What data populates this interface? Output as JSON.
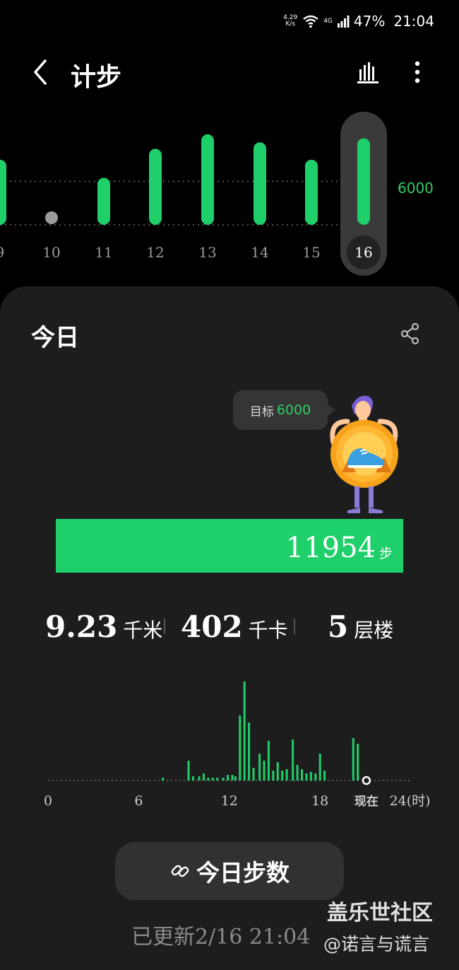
{
  "status_bar": {
    "speed_value": "4.29",
    "speed_unit": "K/s",
    "network": "4G",
    "battery": "47%",
    "time": "21:04"
  },
  "header": {
    "title": "计步",
    "back_icon": "back-icon",
    "chart_icon": "bar-chart-icon",
    "more_icon": "more-vert-icon"
  },
  "week_chart": {
    "goal": 6000,
    "goal_label": "6000",
    "days": [
      "9",
      "10",
      "11",
      "12",
      "13",
      "14",
      "15",
      "16"
    ],
    "steps": [
      9000,
      0,
      6500,
      10500,
      12500,
      11400,
      9000,
      11954
    ],
    "selected": "16",
    "colors": {
      "bar": "#1fcf6a",
      "empty_dot": "#9b9b9b",
      "selected_bg": "#3a3a3a"
    }
  },
  "card": {
    "title": "今日",
    "share_icon": "share-icon",
    "goal_bubble": {
      "label": "目标",
      "value": "6000"
    },
    "mascot_icon": "running-shoe-mascot",
    "steps": {
      "value": "11954",
      "unit": "步",
      "progress_fraction": 1.0
    },
    "stats": {
      "distance": {
        "value": "9.23",
        "unit": "千米"
      },
      "calories": {
        "value": "402",
        "unit": "千卡"
      },
      "floors": {
        "value": "5",
        "unit": "层楼"
      }
    },
    "hourly_chart": {
      "x_tick_labels": [
        "0",
        "6",
        "12",
        "18",
        "现在",
        "24(时)"
      ],
      "values": [
        [
          7.6,
          4
        ],
        [
          9.3,
          28
        ],
        [
          9.6,
          6
        ],
        [
          10.0,
          6
        ],
        [
          10.3,
          10
        ],
        [
          10.6,
          4
        ],
        [
          10.9,
          4
        ],
        [
          11.2,
          4
        ],
        [
          11.6,
          4
        ],
        [
          11.9,
          8
        ],
        [
          12.2,
          8
        ],
        [
          12.4,
          6
        ],
        [
          12.7,
          92
        ],
        [
          13.0,
          140
        ],
        [
          13.3,
          82
        ],
        [
          13.6,
          18
        ],
        [
          14.0,
          38
        ],
        [
          14.3,
          28
        ],
        [
          14.6,
          56
        ],
        [
          14.9,
          14
        ],
        [
          15.2,
          26
        ],
        [
          15.5,
          14
        ],
        [
          15.8,
          16
        ],
        [
          16.2,
          58
        ],
        [
          16.5,
          22
        ],
        [
          16.8,
          16
        ],
        [
          17.1,
          10
        ],
        [
          17.4,
          12
        ],
        [
          17.7,
          10
        ],
        [
          18.0,
          38
        ],
        [
          18.3,
          14
        ],
        [
          20.2,
          60
        ],
        [
          20.5,
          52
        ]
      ],
      "now_hour": 21.07,
      "color": "#1fcf6a"
    },
    "button": {
      "icon": "link-icon",
      "label": "今日步数"
    },
    "updated": "已更新2/16 21:04"
  },
  "watermark": {
    "line1": "盖乐世社区",
    "line2": "@诺言与谎言"
  }
}
